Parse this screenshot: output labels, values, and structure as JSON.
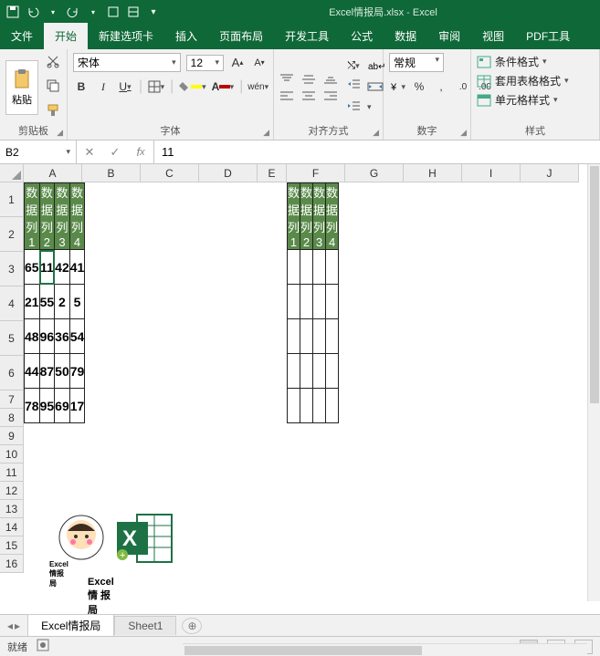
{
  "app": {
    "title": "Excel情报局.xlsx",
    "suffix": "Excel"
  },
  "qat": {
    "save": "save-icon",
    "undo": "undo-icon",
    "redo": "redo-icon"
  },
  "tabs": [
    "文件",
    "开始",
    "新建选项卡",
    "插入",
    "页面布局",
    "开发工具",
    "公式",
    "数据",
    "审阅",
    "视图",
    "PDF工具"
  ],
  "active_tab": 1,
  "ribbon": {
    "clipboard": {
      "label": "剪贴板",
      "paste": "粘贴"
    },
    "font": {
      "label": "字体",
      "name": "宋体",
      "size": "12",
      "buttons": [
        "B",
        "I",
        "U"
      ],
      "wen": "wén"
    },
    "align": {
      "label": "对齐方式",
      "wrap": "ab"
    },
    "number": {
      "label": "数字",
      "format": "常规",
      "pct": "%",
      "comma": ",",
      "dec_inc": ".0←",
      "dec_dec": ".00→"
    },
    "styles": {
      "label": "样式",
      "cond": "条件格式",
      "tbl": "套用表格格式",
      "cell": "单元格样式"
    }
  },
  "namebox": "B2",
  "formula": "11",
  "columns": [
    "A",
    "B",
    "C",
    "D",
    "E",
    "F",
    "G",
    "H",
    "I",
    "J"
  ],
  "rows_tall": [
    1,
    2,
    3,
    4,
    5,
    6
  ],
  "rows_short": [
    7,
    8,
    9,
    10,
    11,
    12,
    13,
    14,
    15,
    16
  ],
  "table1": {
    "headers": [
      "数据列1",
      "数据列2",
      "数据列3",
      "数据列4"
    ],
    "rows": [
      [
        "65",
        "11",
        "42",
        "41"
      ],
      [
        "21",
        "55",
        "2",
        "5"
      ],
      [
        "48",
        "96",
        "36",
        "54"
      ],
      [
        "44",
        "87",
        "50",
        "79"
      ],
      [
        "78",
        "95",
        "69",
        "17"
      ]
    ]
  },
  "table2": {
    "headers": [
      "数据列1",
      "数据列2",
      "数据列3",
      "数据列4"
    ],
    "rows": [
      [
        "",
        "",
        "",
        ""
      ],
      [
        "",
        "",
        "",
        ""
      ],
      [
        "",
        "",
        "",
        ""
      ],
      [
        "",
        "",
        "",
        ""
      ],
      [
        "",
        "",
        "",
        ""
      ]
    ]
  },
  "logo_text": "Excel 情 报 局",
  "logo1_text": "Excel情报局",
  "sheets": {
    "active": "Excel情报局",
    "other": "Sheet1"
  },
  "status": {
    "ready": "就绪"
  },
  "chart_data": {
    "type": "table",
    "title": "",
    "series": [
      {
        "name": "数据列1",
        "values": [
          65,
          21,
          48,
          44,
          78
        ]
      },
      {
        "name": "数据列2",
        "values": [
          11,
          55,
          96,
          87,
          95
        ]
      },
      {
        "name": "数据列3",
        "values": [
          42,
          2,
          36,
          50,
          69
        ]
      },
      {
        "name": "数据列4",
        "values": [
          41,
          5,
          54,
          79,
          17
        ]
      }
    ]
  }
}
